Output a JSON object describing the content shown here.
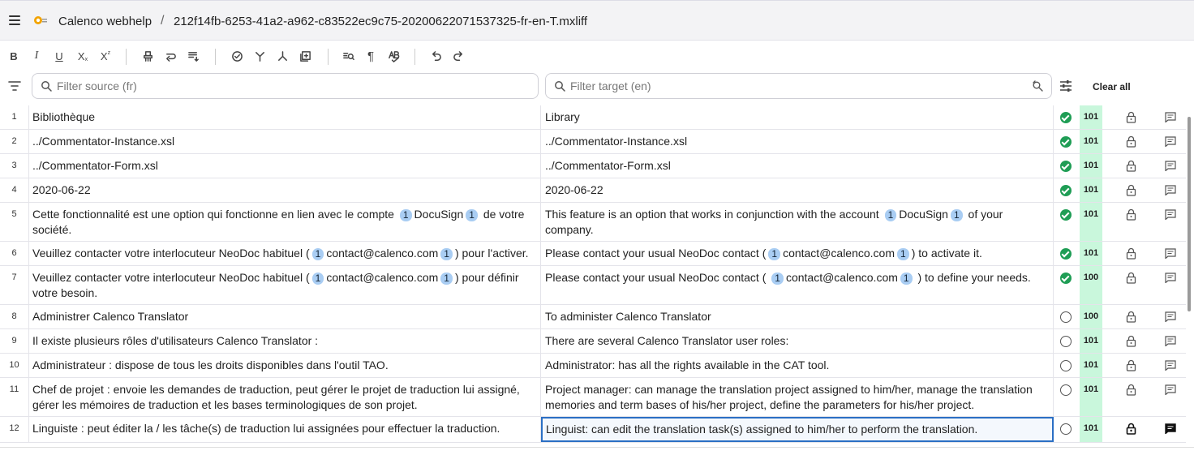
{
  "header": {
    "app_title": "Calenco webhelp",
    "separator": "/",
    "file_name": "212f14fb-6253-41a2-a962-c83522ec9c75-20200622071537325-fr-en-T.mxliff"
  },
  "toolbar": {
    "bold": "B",
    "italic": "I",
    "underline": "U",
    "subscript": "X",
    "superscript": "X"
  },
  "filters": {
    "source_placeholder": "Filter source (fr)",
    "target_placeholder": "Filter target (en)",
    "clear_all": "Clear all"
  },
  "colors": {
    "accent": "#2b6fc4",
    "confirmed": "#1f9d55",
    "score_bg": "#c9f7dc",
    "tag_bg": "#a9cdf3"
  },
  "segments": [
    {
      "num": "1",
      "source": "Bibliothèque",
      "target": "Library",
      "status": "confirmed",
      "score": "101"
    },
    {
      "num": "2",
      "source": "../Commentator-Instance.xsl",
      "target": "../Commentator-Instance.xsl",
      "status": "confirmed",
      "score": "101"
    },
    {
      "num": "3",
      "source": "../Commentator-Form.xsl",
      "target": "../Commentator-Form.xsl",
      "status": "confirmed",
      "score": "101"
    },
    {
      "num": "4",
      "source": "2020-06-22",
      "target": "2020-06-22",
      "status": "confirmed",
      "score": "101"
    },
    {
      "num": "5",
      "source_parts": [
        "Cette fonctionnalité est une option qui fonctionne en lien avec le compte ",
        "1",
        "DocuSign",
        "1",
        " de votre société."
      ],
      "target_parts": [
        "This feature is an option that works in conjunction with the account ",
        "1",
        "DocuSign",
        "1",
        " of your company."
      ],
      "status": "confirmed",
      "score": "101"
    },
    {
      "num": "6",
      "source_parts": [
        "Veuillez contacter votre interlocuteur NeoDoc habituel (",
        "1",
        "contact@calenco.com",
        "1",
        ") pour l'activer."
      ],
      "target_parts": [
        "Please contact your usual NeoDoc contact (",
        "1",
        "contact@calenco.com",
        "1",
        ") to activate it."
      ],
      "status": "confirmed",
      "score": "101"
    },
    {
      "num": "7",
      "source_parts": [
        "Veuillez contacter votre interlocuteur NeoDoc habituel (",
        "1",
        "contact@calenco.com",
        "1",
        ") pour définir votre besoin."
      ],
      "target_parts": [
        "Please contact your usual NeoDoc contact ( ",
        "1",
        "contact@calenco.com",
        "1",
        " ) to define your needs."
      ],
      "status": "confirmed",
      "score": "100"
    },
    {
      "num": "8",
      "source": "Administrer Calenco Translator",
      "target": "To administer Calenco Translator",
      "status": "empty",
      "score": "100"
    },
    {
      "num": "9",
      "source": "Il existe plusieurs rôles d'utilisateurs Calenco Translator :",
      "target": "There are several Calenco Translator user roles:",
      "status": "empty",
      "score": "101"
    },
    {
      "num": "10",
      "source": "Administrateur : dispose de tous les droits disponibles dans l'outil TAO.",
      "target": "Administrator: has all the rights available in the CAT tool.",
      "status": "empty",
      "score": "101"
    },
    {
      "num": "11",
      "source": "Chef de projet : envoie les demandes de traduction, peut gérer le projet de traduction lui assigné, gérer les mémoires de traduction et les bases terminologiques de son projet.",
      "target": "Project manager: can manage the translation project assigned to him/her, manage the translation memories and term bases of his/her project, define the parameters for his/her project.",
      "status": "empty",
      "score": "101"
    },
    {
      "num": "12",
      "source": "Linguiste : peut éditer la / les tâche(s) de traduction lui assignées pour effectuer la traduction.",
      "target": "Linguist: can edit the translation task(s) assigned to him/her to perform the translation.",
      "status": "empty",
      "score": "101"
    }
  ]
}
